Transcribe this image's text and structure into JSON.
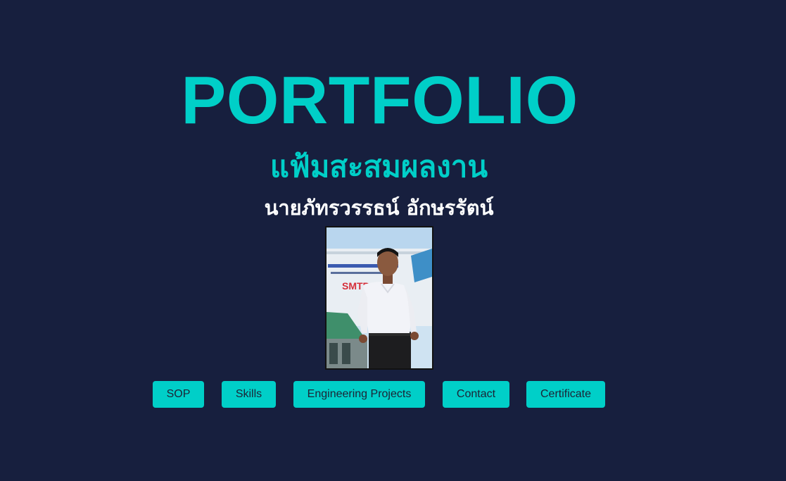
{
  "header": {
    "title": "PORTFOLIO",
    "subtitle_thai": "แฟ้มสะสมผลงาน",
    "owner_name": "นายภัทรวรรธน์ อักษรรัตน์"
  },
  "photo": {
    "sign_text": "SMTP"
  },
  "nav": {
    "sop": "SOP",
    "skills": "Skills",
    "engineering_projects": "Engineering Projects",
    "contact": "Contact",
    "certificate": "Certificate"
  },
  "colors": {
    "background": "#171f3e",
    "accent": "#00cfc8",
    "name_text": "#ffffff",
    "button_text": "#1c2335"
  }
}
